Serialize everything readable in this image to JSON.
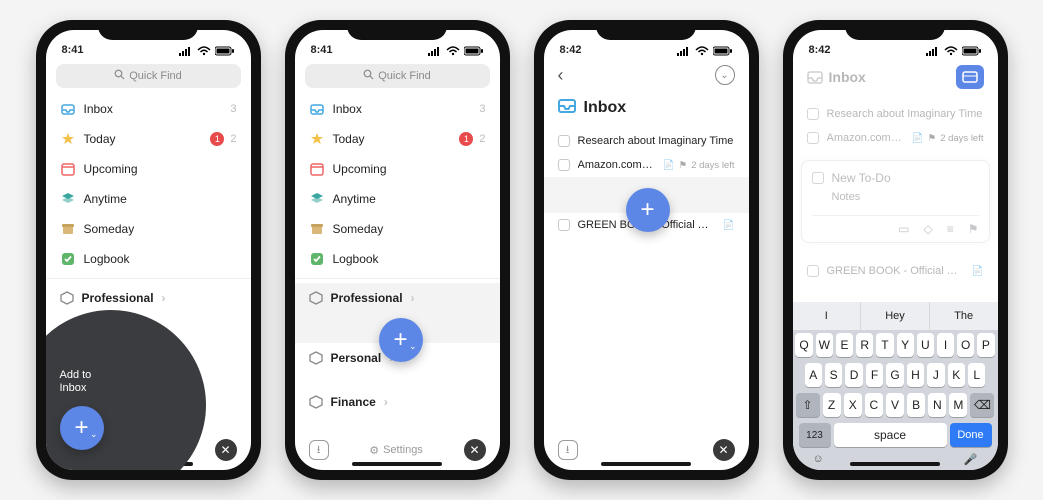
{
  "status": {
    "time1": "8:41",
    "time2": "8:41",
    "time3": "8:42",
    "time4": "8:42"
  },
  "quickfind": {
    "placeholder": "Quick Find"
  },
  "nav": {
    "inbox": "Inbox",
    "inbox_count": "3",
    "today": "Today",
    "today_badge": "1",
    "today_count": "2",
    "upcoming": "Upcoming",
    "anytime": "Anytime",
    "someday": "Someday",
    "logbook": "Logbook"
  },
  "areas": {
    "professional": "Professional",
    "personal": "Personal",
    "finance": "Finance"
  },
  "bottom": {
    "settings": "Settings"
  },
  "bubble": {
    "line1": "Add to",
    "line2": "Inbox"
  },
  "screen3": {
    "title": "Inbox",
    "t1": "Research about Imaginary Time",
    "t2": "Amazon.com Associat...",
    "t2_meta": "2 days left",
    "t3": "GREEN BOOK - Official Trailer [HD..."
  },
  "screen4": {
    "title": "Inbox",
    "t1": "Research about Imaginary Time",
    "t2": "Amazon.com Associat...",
    "t2_meta": "2 days left",
    "t3": "GREEN BOOK - Official Trailer [HD...",
    "newtodo": "New To-Do",
    "notes": "Notes"
  },
  "keyboard": {
    "sugg1": "I",
    "sugg2": "Hey",
    "sugg3": "The",
    "r1": [
      "Q",
      "W",
      "E",
      "R",
      "T",
      "Y",
      "U",
      "I",
      "O",
      "P"
    ],
    "r2": [
      "A",
      "S",
      "D",
      "F",
      "G",
      "H",
      "J",
      "K",
      "L"
    ],
    "r3": [
      "Z",
      "X",
      "C",
      "V",
      "B",
      "N",
      "M"
    ],
    "num": "123",
    "space": "space",
    "done": "Done"
  }
}
